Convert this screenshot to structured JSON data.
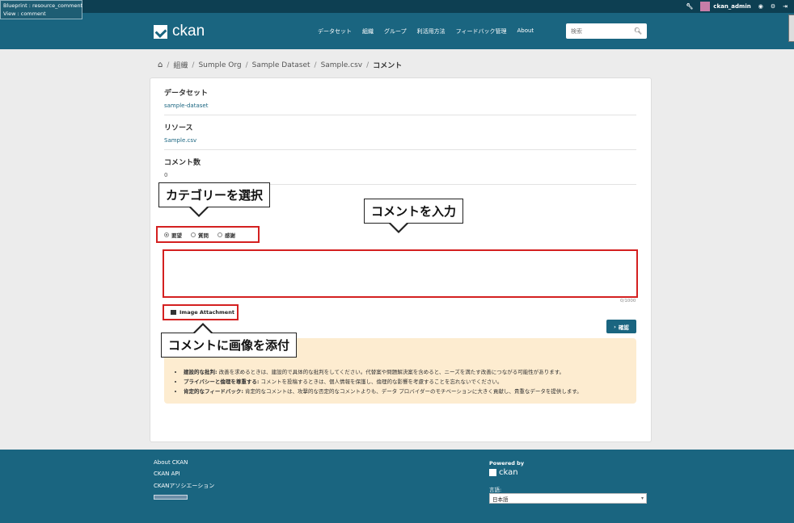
{
  "debug": {
    "blueprint": "Blueprint : resource_comment",
    "view": "View : comment"
  },
  "user": {
    "name": "ckan_admin",
    "icons": [
      "wrench-icon",
      "dashboard-icon",
      "settings-icon",
      "logout-icon"
    ]
  },
  "brand": {
    "logo_text": "ckan"
  },
  "nav": {
    "items": [
      "データセット",
      "組織",
      "グループ",
      "利活用方法",
      "フィードバック管理",
      "About"
    ]
  },
  "search": {
    "placeholder": "検索"
  },
  "breadcrumb": {
    "items": [
      "組織",
      "Sumple Org",
      "Sample Dataset",
      "Sample.csv"
    ],
    "active": "コメント"
  },
  "details": {
    "dataset_label": "データセット",
    "dataset_value": "sample-dataset",
    "resource_label": "リソース",
    "resource_value": "Sample.csv",
    "count_label": "コメント数",
    "count_value": "0"
  },
  "callouts": {
    "category": "カテゴリーを選択",
    "comment": "コメントを入力",
    "attach": "コメントに画像を添付"
  },
  "categories": {
    "options": [
      "要望",
      "質問",
      "感謝"
    ],
    "selected": "要望"
  },
  "comment": {
    "counter": "0/1000"
  },
  "attachment": {
    "label": "Image Attachment"
  },
  "confirm": {
    "label": "確認"
  },
  "guidelines": [
    {
      "title": "建設的な批判:",
      "text": " 改善を求めるときは、建設的で具体的な批判をしてください。代替案や問題解決案を含めると、ニーズを満たす改善につながる可能性があります。"
    },
    {
      "title": "プライバシーと倫理を尊重する:",
      "text": " コメントを投稿するときは、個人情報を保護し、倫理的な影響を考慮することを忘れないでください。"
    },
    {
      "title": "肯定的なフィードバック:",
      "text": " 肯定的なコメントは、攻撃的な否定的なコメントよりも、データ プロバイダーのモチベーションに大きく貢献し、貴重なデータを提供します。"
    }
  ],
  "footer": {
    "links": [
      "About CKAN",
      "CKAN API",
      "CKANアソシエーション"
    ],
    "powered_by": "Powered by",
    "powered_logo": "ckan",
    "language_label": "言語:",
    "language_value": "日本語"
  },
  "colors": {
    "primary": "#1a6580",
    "topbar": "#0d3f52",
    "highlight": "#d42020",
    "guideline_bg": "#fdecd0"
  }
}
